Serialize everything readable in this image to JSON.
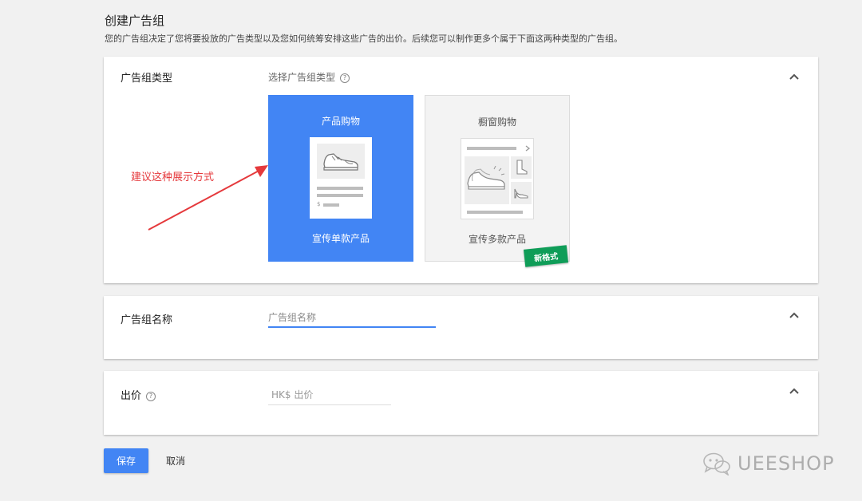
{
  "header": {
    "title": "创建广告组",
    "description": "您的广告组决定了您将要投放的广告类型以及您如何统筹安排这些广告的出价。后续您可以制作更多个属于下面这两种类型的广告组。"
  },
  "ad_group_type": {
    "label": "广告组类型",
    "hint": "选择广告组类型",
    "options": [
      {
        "title": "产品购物",
        "caption": "宣传单款产品",
        "selected": true
      },
      {
        "title": "橱窗购物",
        "caption": "宣传多款产品",
        "badge": "新格式",
        "selected": false
      }
    ],
    "illustration_price": "$"
  },
  "ad_group_name": {
    "label": "广告组名称",
    "placeholder": "广告组名称"
  },
  "bid": {
    "label": "出价",
    "placeholder": "HK$ 出价"
  },
  "actions": {
    "save_label": "保存",
    "cancel_label": "取消"
  },
  "annotation": {
    "text": "建议这种展示方式",
    "color": "#e5393c"
  },
  "watermark": {
    "text": "UEESHOP"
  },
  "colors": {
    "primary": "#4285f4",
    "badge": "#0f9d58",
    "background": "#f1f1f1"
  },
  "icons": {
    "help": "help-circle-icon",
    "collapse": "chevron-up-icon",
    "product": "sneaker-icon",
    "showcase_extra": [
      "boot-icon",
      "heel-shoe-icon"
    ],
    "watermark": "wechat-icon"
  }
}
